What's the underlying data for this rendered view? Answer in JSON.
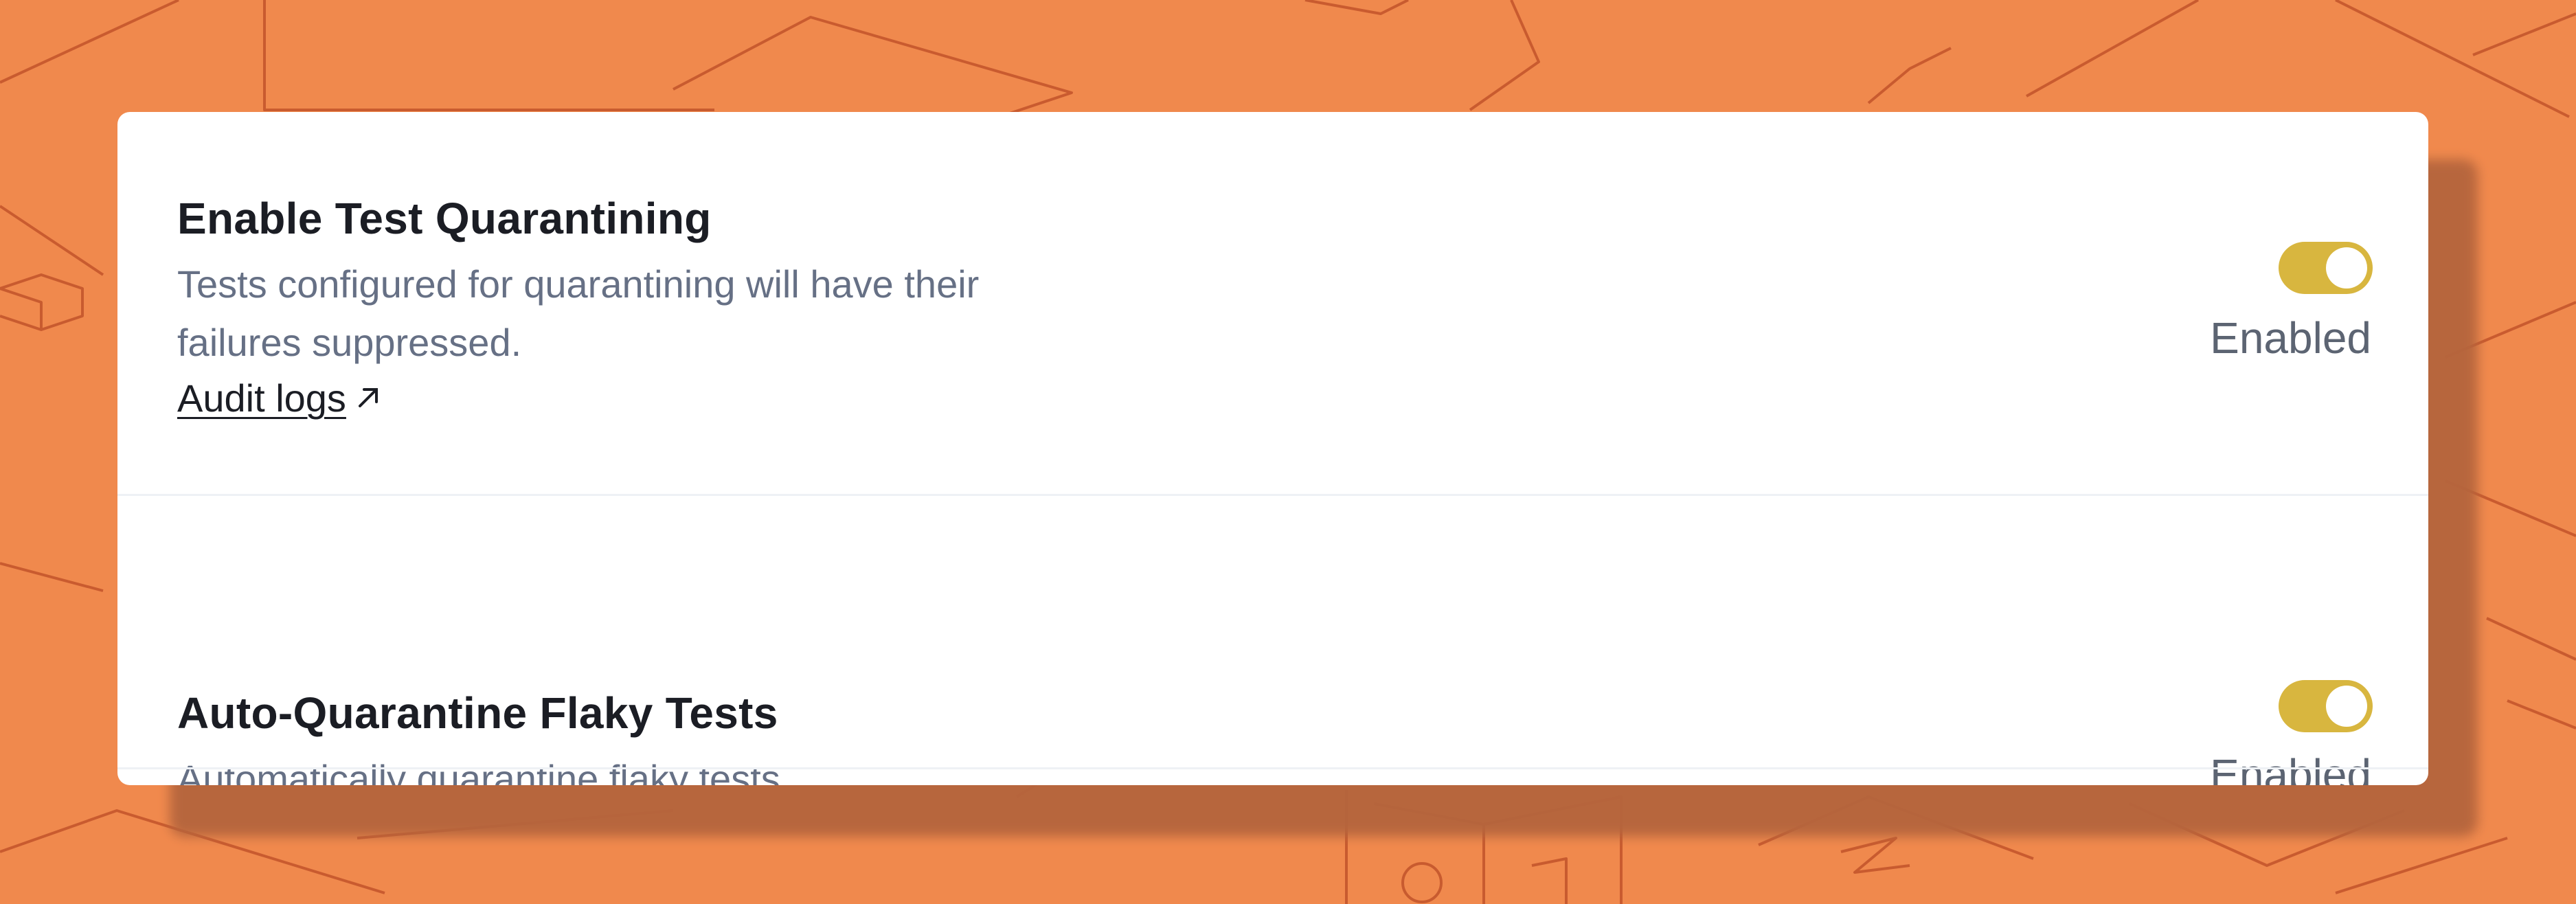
{
  "settings": [
    {
      "title": "Enable Test Quarantining",
      "description": "Tests configured for quarantining will have their failures suppressed.",
      "link_label": "Audit logs",
      "link_icon": "external-link-icon",
      "toggle_on": true,
      "status": "Enabled"
    },
    {
      "title": "Auto-Quarantine Flaky Tests",
      "description": "Automatically quarantine flaky tests",
      "toggle_on": true,
      "status": "Enabled"
    }
  ],
  "colors": {
    "background": "#f0894d",
    "toggle_on": "#d8b63f",
    "title": "#1b1d24",
    "description": "#667085"
  }
}
